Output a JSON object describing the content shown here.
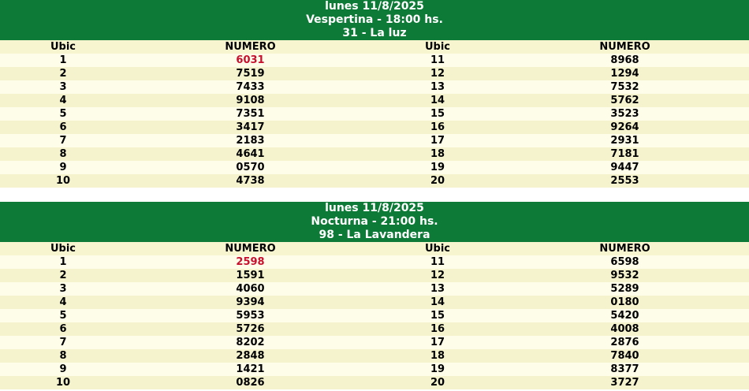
{
  "draws": [
    {
      "date_line": "lunes 11/8/2025",
      "session_line": "Vespertina - 18:00 hs.",
      "head_line": "31 - La luz",
      "columns": {
        "ubic": "Ubic",
        "numero": "NUMERO"
      },
      "rows": [
        {
          "u1": "1",
          "n1": "6031",
          "u2": "11",
          "n2": "8968"
        },
        {
          "u1": "2",
          "n1": "7519",
          "u2": "12",
          "n2": "1294"
        },
        {
          "u1": "3",
          "n1": "7433",
          "u2": "13",
          "n2": "7532"
        },
        {
          "u1": "4",
          "n1": "9108",
          "u2": "14",
          "n2": "5762"
        },
        {
          "u1": "5",
          "n1": "7351",
          "u2": "15",
          "n2": "3523"
        },
        {
          "u1": "6",
          "n1": "3417",
          "u2": "16",
          "n2": "9264"
        },
        {
          "u1": "7",
          "n1": "2183",
          "u2": "17",
          "n2": "2931"
        },
        {
          "u1": "8",
          "n1": "4641",
          "u2": "18",
          "n2": "7181"
        },
        {
          "u1": "9",
          "n1": "0570",
          "u2": "19",
          "n2": "9447"
        },
        {
          "u1": "10",
          "n1": "4738",
          "u2": "20",
          "n2": "2553"
        }
      ]
    },
    {
      "date_line": "lunes 11/8/2025",
      "session_line": "Nocturna - 21:00 hs.",
      "head_line": "98 - La Lavandera",
      "columns": {
        "ubic": "Ubic",
        "numero": "NUMERO"
      },
      "rows": [
        {
          "u1": "1",
          "n1": "2598",
          "u2": "11",
          "n2": "6598"
        },
        {
          "u1": "2",
          "n1": "1591",
          "u2": "12",
          "n2": "9532"
        },
        {
          "u1": "3",
          "n1": "4060",
          "u2": "13",
          "n2": "5289"
        },
        {
          "u1": "4",
          "n1": "9394",
          "u2": "14",
          "n2": "0180"
        },
        {
          "u1": "5",
          "n1": "5953",
          "u2": "15",
          "n2": "5420"
        },
        {
          "u1": "6",
          "n1": "5726",
          "u2": "16",
          "n2": "4008"
        },
        {
          "u1": "7",
          "n1": "8202",
          "u2": "17",
          "n2": "2876"
        },
        {
          "u1": "8",
          "n1": "2848",
          "u2": "18",
          "n2": "7840"
        },
        {
          "u1": "9",
          "n1": "1421",
          "u2": "19",
          "n2": "8377"
        },
        {
          "u1": "10",
          "n1": "0826",
          "u2": "20",
          "n2": "3727"
        }
      ]
    }
  ],
  "colors": {
    "header_green": "#0e7a37",
    "row_light": "#fefde9",
    "row_dark": "#f4f3ce",
    "head_number_red": "#c8102e"
  }
}
